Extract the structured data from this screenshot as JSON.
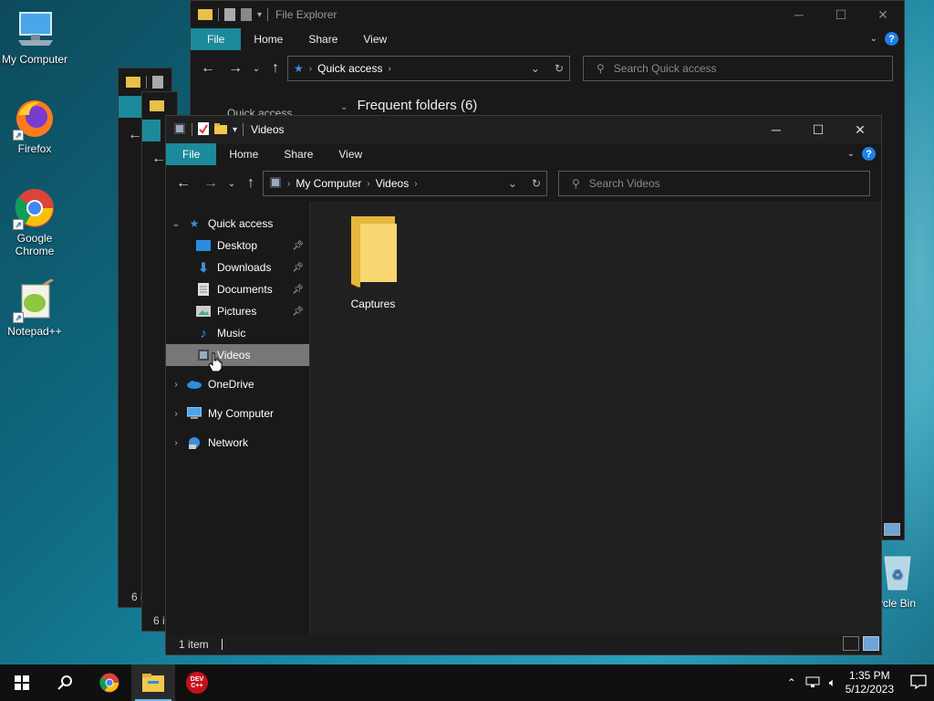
{
  "desktop": {
    "icons": [
      {
        "label": "My Computer"
      },
      {
        "label": "Firefox"
      },
      {
        "label": "Google Chrome"
      },
      {
        "label": "Notepad++"
      },
      {
        "label": "Recycle Bin",
        "partial_label": "ycle Bin"
      }
    ]
  },
  "back_window": {
    "title": "File Explorer",
    "ribbon_tabs": [
      "File",
      "Home",
      "Share",
      "View"
    ],
    "address_crumb": "Quick access",
    "search_placeholder": "Search Quick access",
    "section_header": "Frequent folders (6)",
    "nav_peek": "Quick access"
  },
  "mid_windows": {
    "status_a": "6 i",
    "status_b": "6 i"
  },
  "front_window": {
    "title": "Videos",
    "ribbon_tabs": [
      "File",
      "Home",
      "Share",
      "View"
    ],
    "address": [
      "My Computer",
      "Videos"
    ],
    "search_placeholder": "Search Videos",
    "nav": {
      "quick_access": "Quick access",
      "items": [
        {
          "label": "Desktop",
          "pinned": true
        },
        {
          "label": "Downloads",
          "pinned": true
        },
        {
          "label": "Documents",
          "pinned": true
        },
        {
          "label": "Pictures",
          "pinned": true
        },
        {
          "label": "Music",
          "pinned": false
        },
        {
          "label": "Videos",
          "pinned": false
        }
      ],
      "onedrive": "OneDrive",
      "my_computer": "My Computer",
      "network": "Network"
    },
    "content_items": [
      {
        "label": "Captures",
        "type": "folder"
      }
    ],
    "status": "1 item"
  },
  "taskbar": {
    "time": "1:35 PM",
    "date": "5/12/2023",
    "devcpp_label": "DEV C++"
  },
  "colors": {
    "ribbon_file_tab": "#1b8a9a",
    "selection": "#777777",
    "folder_yellow": "#f3c94d",
    "accent_blue": "#1e7fe6"
  }
}
